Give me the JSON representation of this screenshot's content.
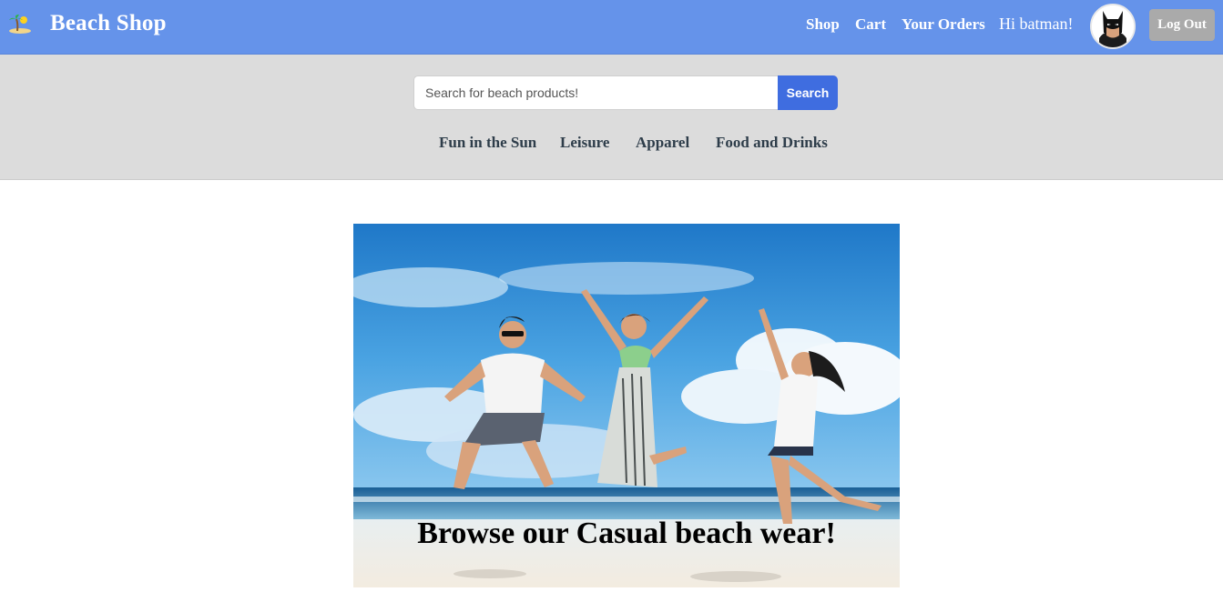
{
  "header": {
    "brand": "Beach Shop",
    "brand_icon": "beach-island-icon",
    "nav": [
      {
        "label": "Shop"
      },
      {
        "label": "Cart"
      },
      {
        "label": "Your Orders"
      }
    ],
    "greeting": "Hi batman!",
    "avatar_icon": "batman-avatar",
    "logout_label": "Log Out",
    "bg_color": "#6593ea"
  },
  "search": {
    "placeholder": "Search for beach products!",
    "value": "",
    "button_label": "Search",
    "button_color": "#3f6de0"
  },
  "categories": [
    {
      "label": "Fun in the Sun"
    },
    {
      "label": "Leisure"
    },
    {
      "label": "Apparel"
    },
    {
      "label": "Food and Drinks"
    }
  ],
  "hero": {
    "caption": "Browse our Casual beach wear!",
    "image": "people-jumping-on-beach-photo"
  }
}
